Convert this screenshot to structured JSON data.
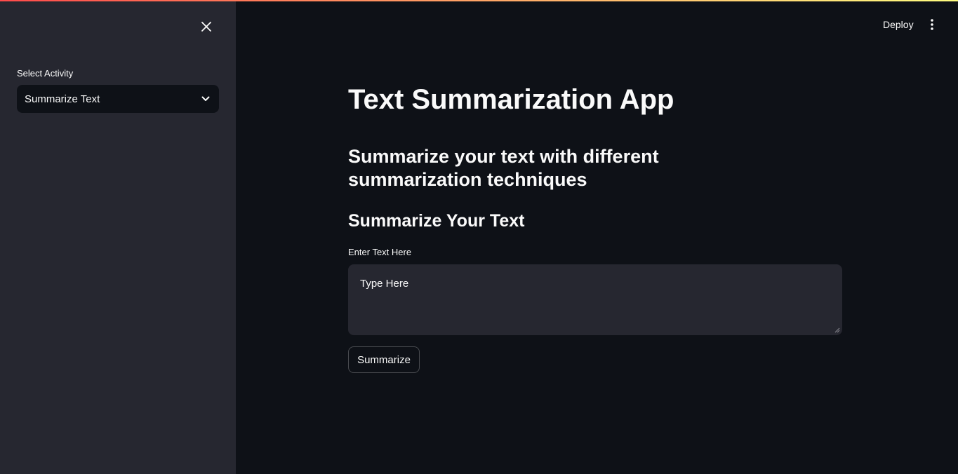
{
  "sidebar": {
    "close_icon": "close-icon",
    "select_label": "Select Activity",
    "select_value": "Summarize Text",
    "select_icon": "chevron-down-icon"
  },
  "header": {
    "deploy_label": "Deploy",
    "menu_icon": "vertical-ellipsis-icon"
  },
  "main": {
    "title": "Text Summarization App",
    "subtitle": "Summarize your text with different summarization techniques",
    "section_title": "Summarize Your Text",
    "input_label": "Enter Text Here",
    "input_value": "Type Here",
    "button_label": "Summarize"
  },
  "colors": {
    "background": "#0e1117",
    "sidebar": "#262730",
    "text": "#fafafa",
    "accent_gradient_start": "#ff4b4b",
    "accent_gradient_end": "#fffd80"
  }
}
